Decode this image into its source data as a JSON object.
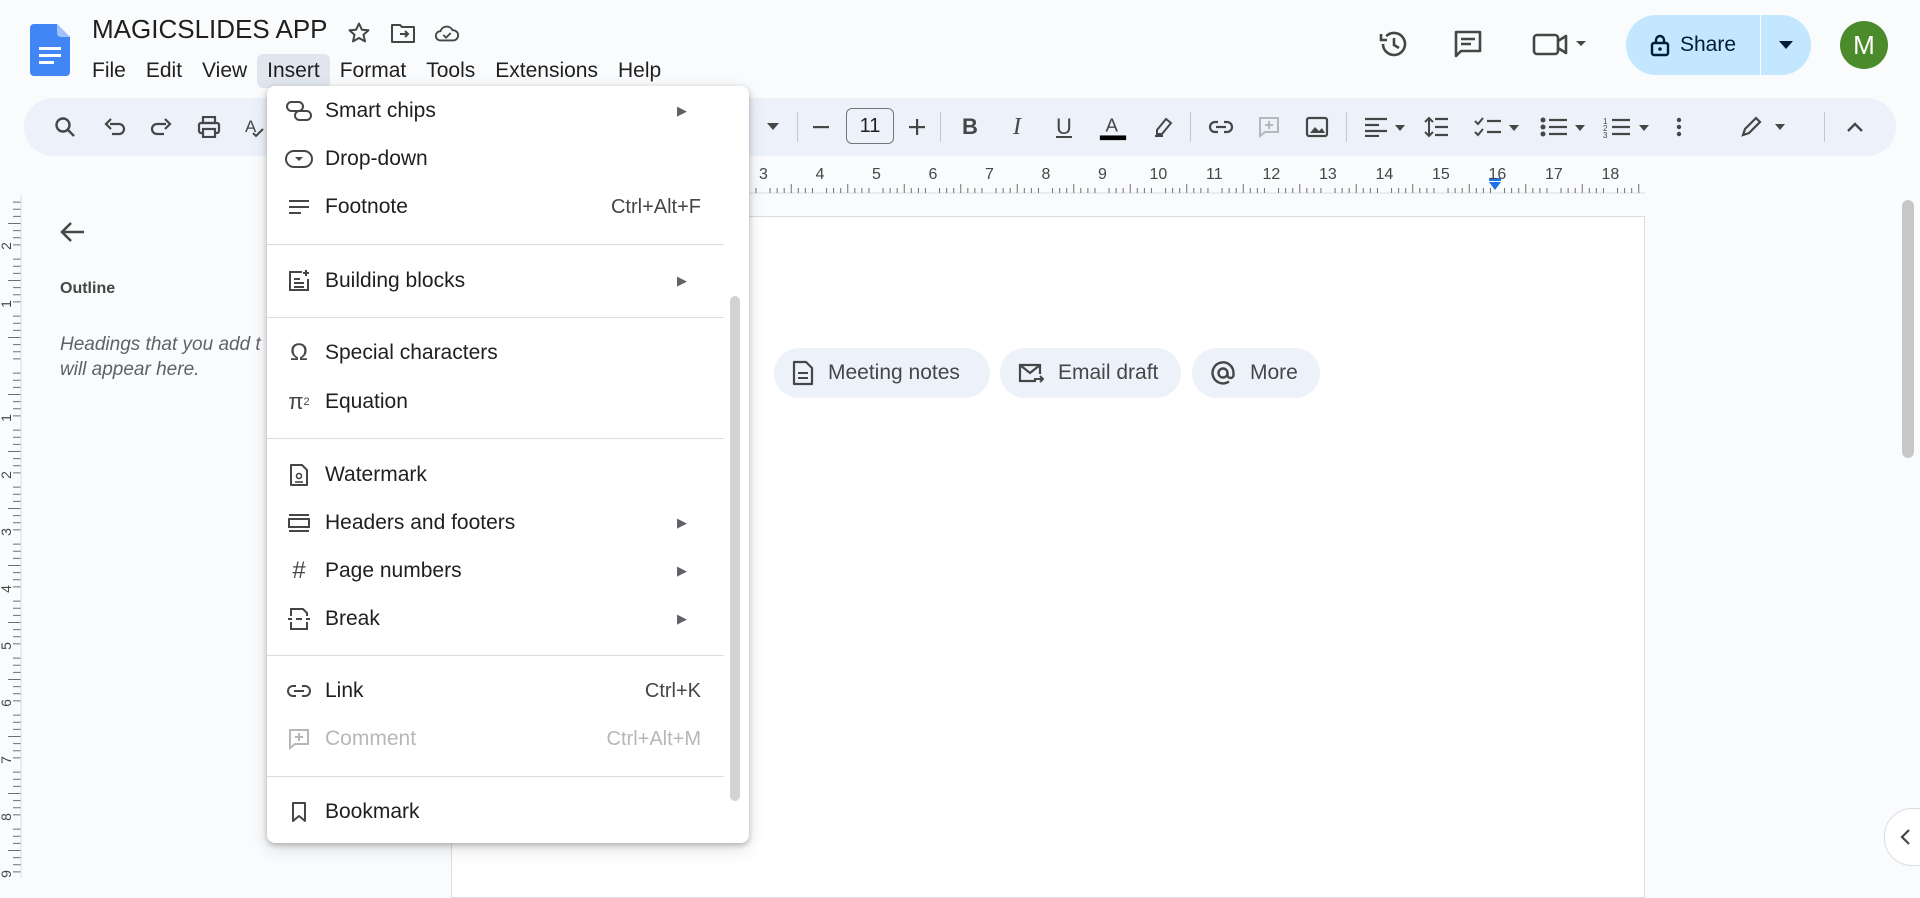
{
  "doc": {
    "title": "MAGICSLIDES APP"
  },
  "menubar": [
    "File",
    "Edit",
    "View",
    "Insert",
    "Format",
    "Tools",
    "Extensions",
    "Help"
  ],
  "share": {
    "label": "Share"
  },
  "user": {
    "avatar_letter": "M",
    "avatar_color": "#4b8b2c"
  },
  "toolbar": {
    "font_size": "11"
  },
  "ruler": {
    "numbers": [
      "3",
      "4",
      "5",
      "6",
      "7",
      "8",
      "9",
      "10",
      "11",
      "12",
      "13",
      "14",
      "15",
      "16",
      "17",
      "18"
    ]
  },
  "left_ruler": {
    "numbers": [
      "2",
      "1",
      "1",
      "2",
      "3",
      "4",
      "5",
      "6",
      "7",
      "8",
      "9"
    ]
  },
  "outline": {
    "label": "Outline",
    "hint": "Headings that you add to the document will appear here.",
    "hint_visible": "Headings that you add t\nwill appear here."
  },
  "chips": [
    {
      "label": "Meeting notes",
      "icon": "document-icon"
    },
    {
      "label": "Email draft",
      "icon": "email-icon"
    },
    {
      "label": "More",
      "icon": "at-icon"
    }
  ],
  "insert_menu": {
    "items": [
      {
        "label": "Smart chips",
        "icon": "smart-chips-icon",
        "submenu": true
      },
      {
        "label": "Drop-down",
        "icon": "dropdown-chip-icon"
      },
      {
        "label": "Footnote",
        "icon": "footnote-icon",
        "shortcut": "Ctrl+Alt+F"
      },
      {
        "label": "Building blocks",
        "icon": "building-blocks-icon",
        "submenu": true
      },
      {
        "label": "Special characters",
        "icon": "omega-icon"
      },
      {
        "label": "Equation",
        "icon": "pi-icon"
      },
      {
        "label": "Watermark",
        "icon": "watermark-icon"
      },
      {
        "label": "Headers and footers",
        "icon": "header-footer-icon",
        "submenu": true
      },
      {
        "label": "Page numbers",
        "icon": "hash-icon",
        "submenu": true
      },
      {
        "label": "Break",
        "icon": "break-icon",
        "submenu": true
      },
      {
        "label": "Link",
        "icon": "link-icon",
        "shortcut": "Ctrl+K"
      },
      {
        "label": "Comment",
        "icon": "add-comment-icon",
        "shortcut": "Ctrl+Alt+M",
        "disabled": true
      },
      {
        "label": "Bookmark",
        "icon": "bookmark-icon"
      }
    ]
  },
  "colors": {
    "accent": "#1a73e8",
    "share_bg": "#c2e7ff",
    "toolbar_bg": "#edf2fa"
  }
}
